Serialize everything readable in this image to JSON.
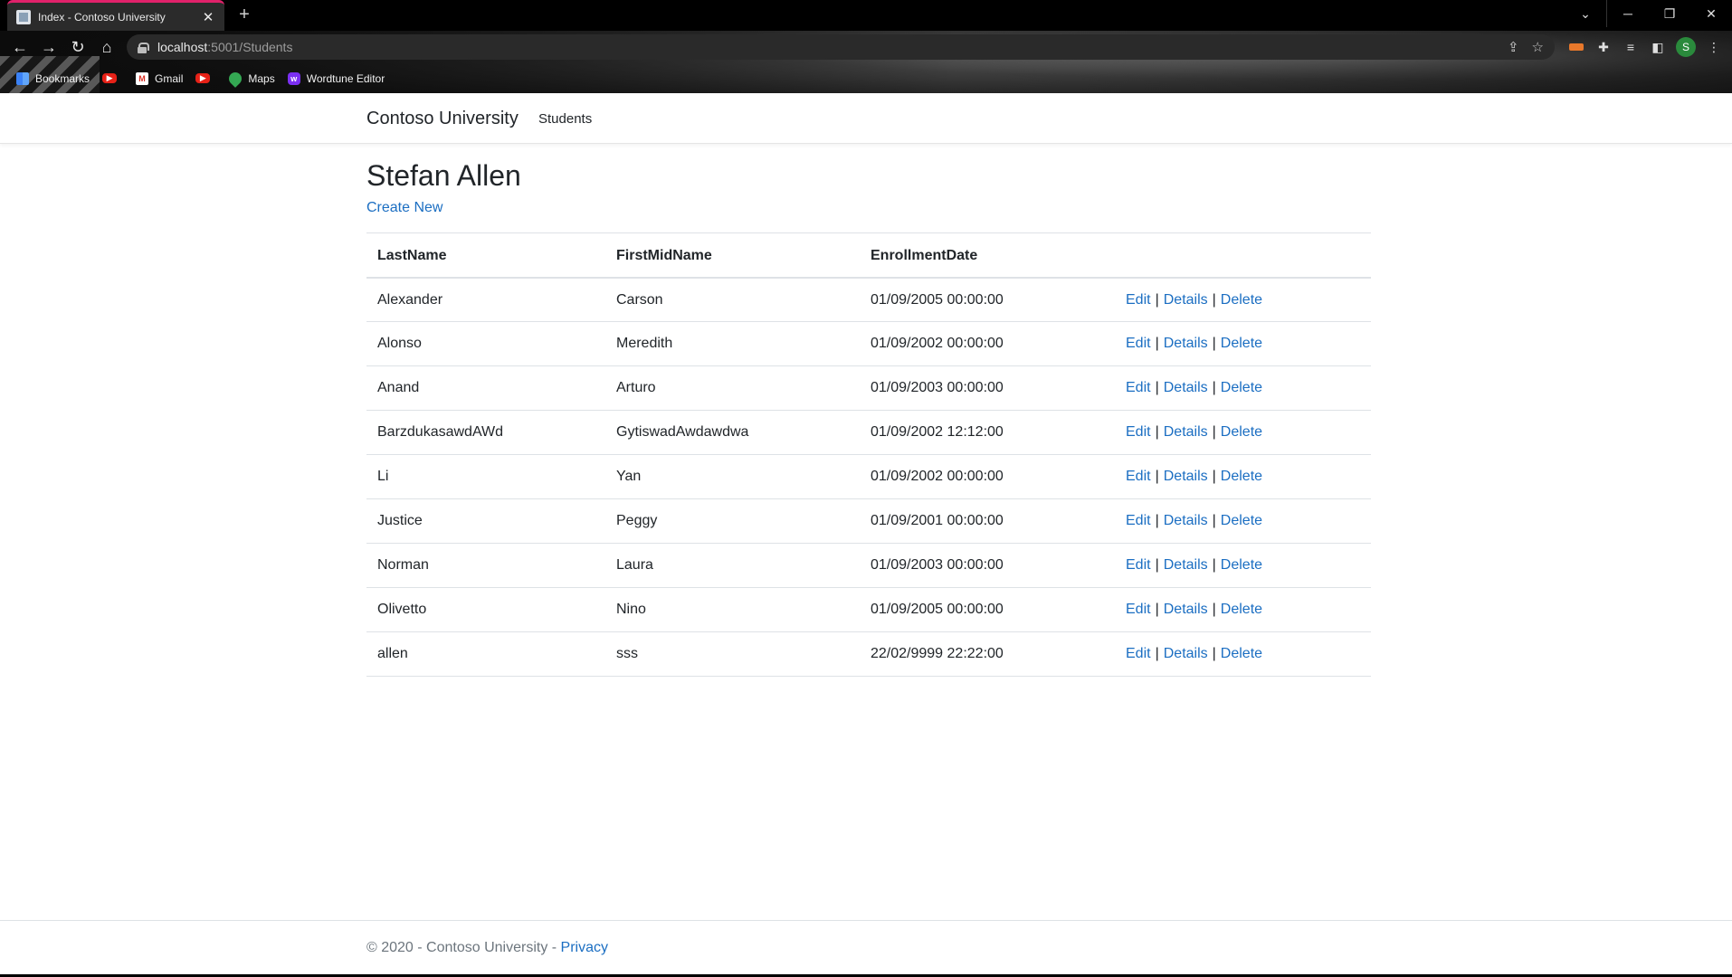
{
  "browser": {
    "tab_title": "Index - Contoso University",
    "url_host": "localhost",
    "url_path": ":5001/Students",
    "bookmarks": [
      {
        "label": "Bookmarks",
        "icon": "apps-grid-icon"
      },
      {
        "label": "",
        "icon": "youtube-icon"
      },
      {
        "label": "Gmail",
        "icon": "gmail-icon"
      },
      {
        "label": "",
        "icon": "youtube-icon"
      },
      {
        "label": "Maps",
        "icon": "maps-icon"
      },
      {
        "label": "Wordtune Editor",
        "icon": "wordtune-icon"
      }
    ],
    "profile_initial": "S"
  },
  "navbar": {
    "brand": "Contoso University",
    "links": [
      "Students"
    ]
  },
  "main": {
    "heading": "Stefan Allen",
    "create_link": "Create New",
    "columns": [
      "LastName",
      "FirstMidName",
      "EnrollmentDate",
      ""
    ],
    "rows": [
      {
        "last": "Alexander",
        "first": "Carson",
        "date": "01/09/2005 00:00:00"
      },
      {
        "last": "Alonso",
        "first": "Meredith",
        "date": "01/09/2002 00:00:00"
      },
      {
        "last": "Anand",
        "first": "Arturo",
        "date": "01/09/2003 00:00:00"
      },
      {
        "last": "BarzdukasawdAWd",
        "first": "GytiswadAwdawdwa",
        "date": "01/09/2002 12:12:00"
      },
      {
        "last": "Li",
        "first": "Yan",
        "date": "01/09/2002 00:00:00"
      },
      {
        "last": "Justice",
        "first": "Peggy",
        "date": "01/09/2001 00:00:00"
      },
      {
        "last": "Norman",
        "first": "Laura",
        "date": "01/09/2003 00:00:00"
      },
      {
        "last": "Olivetto",
        "first": "Nino",
        "date": "01/09/2005 00:00:00"
      },
      {
        "last": "allen",
        "first": "sss",
        "date": "22/02/9999 22:22:00"
      }
    ],
    "actions": {
      "edit": "Edit",
      "details": "Details",
      "delete": "Delete",
      "separator": "|"
    }
  },
  "footer": {
    "text": "© 2020 - Contoso University - ",
    "privacy": "Privacy"
  },
  "colors": {
    "link": "#1b6ec2",
    "tab_accent": "#e0216a",
    "text": "#212529",
    "muted": "#6c757d"
  }
}
